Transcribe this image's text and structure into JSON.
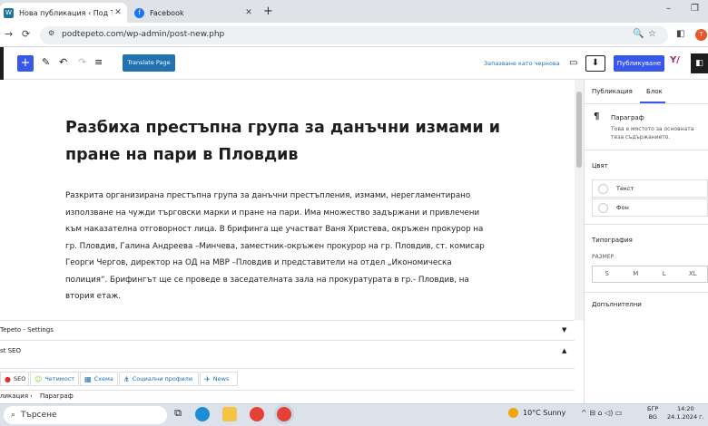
{
  "browser": {
    "tabs": [
      {
        "title": "Нова публикация ‹ Под Тепето",
        "icon": "wordpress-icon",
        "active": true
      },
      {
        "title": "Facebook",
        "icon": "facebook-icon",
        "active": false
      }
    ],
    "url": "podtepeto.com/wp-admin/post-new.php",
    "profile_initial": "T"
  },
  "editor": {
    "toolbar": {
      "translate_label": "Translate Page",
      "save_draft_label": "Запазване като чернова",
      "publish_label": "Публикуване"
    },
    "post": {
      "title": "Разбиха престъпна група за данъчни измами и пране на пари в Пловдив",
      "body": "Разкрита организирана престъпна група за данъчни престъпления, измами, нерегламентирано използване на чужди търговски марки и пране на пари. Има множество задържани и привлечени към наказателна отговорност лица.  В  брифинга ще участват Ваня Христева, окръжен прокурор на гр. Пловдив, Галина Андреева –Минчева, заместник-окръжен прокурор на гр. Пловдив, ст. комисар Георги Чергов, директор на ОД на МВР –Пловдив и представители на отдел „Икономическа полиция“.  Брифингът ще се проведе в заседателната зала на прокуратурата в гр.- Пловдив, на втория етаж."
    },
    "meta_boxes": [
      {
        "label": "Tepeto - Settings",
        "state": "collapsed"
      },
      {
        "label": "st SEO",
        "state": "expanded"
      }
    ],
    "yoast_tabs": [
      "SEO",
      "Четимост",
      "Схема",
      "Социални профили",
      "News"
    ],
    "breadcrumb": [
      "ликация",
      "Параграф"
    ]
  },
  "sidebar": {
    "tabs": [
      "Публикация",
      "Блок"
    ],
    "active_tab": "Блок",
    "block_name": "Параграф",
    "block_desc": "Това е мястото за основната теза съдържанието.",
    "color_heading": "Цвят",
    "color_options": [
      "Текст",
      "Фон"
    ],
    "typography_heading": "Типография",
    "size_label": "РАЗМЕР",
    "sizes": [
      "S",
      "M",
      "L",
      "XL"
    ],
    "advanced_heading": "Допълнителни"
  },
  "taskbar": {
    "search_placeholder": "Търсене",
    "weather": "10°C  Sunny",
    "language_top": "БГР",
    "language_bottom": "BG",
    "time": "14:20",
    "date": "24.1.2024 г."
  },
  "colors": {
    "accent": "#3858e9",
    "link": "#2271b1"
  }
}
